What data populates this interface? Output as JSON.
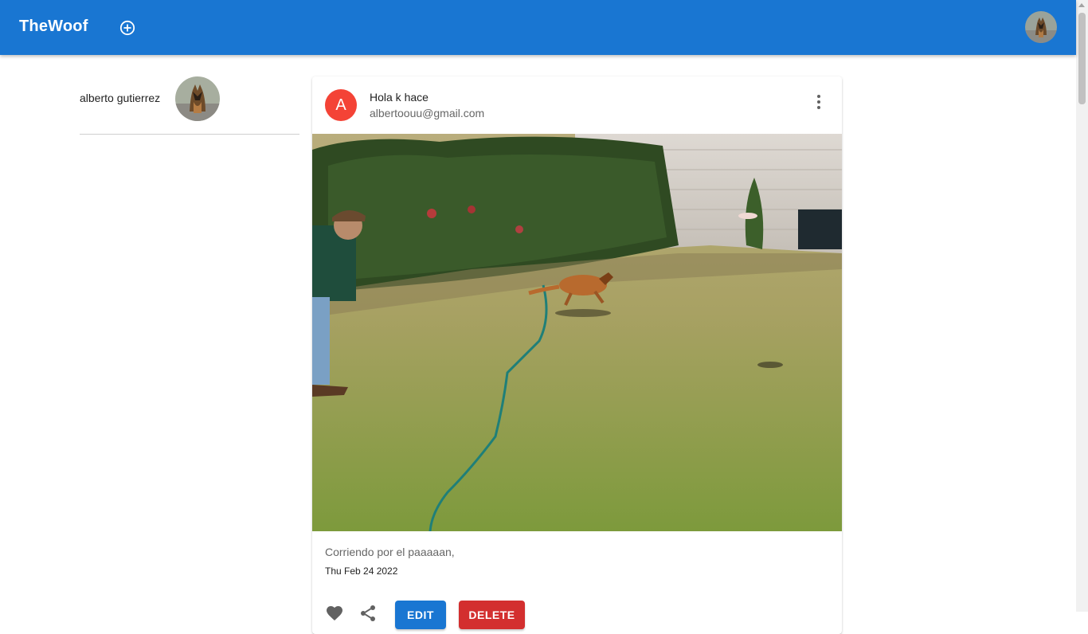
{
  "app": {
    "title": "TheWoof"
  },
  "header": {
    "add_icon": "add-circle-icon",
    "avatar_alt": "user-avatar"
  },
  "sidebar": {
    "profile_name": "alberto gutierrez"
  },
  "post": {
    "avatar_letter": "A",
    "title": "Hola k hace",
    "subtitle": "albertoouu@gmail.com",
    "description": "Corriendo por el paaaaan,",
    "date": "Thu Feb 24 2022",
    "actions": {
      "like_icon": "heart-icon",
      "share_icon": "share-icon",
      "edit_label": "EDIT",
      "delete_label": "DELETE"
    }
  },
  "colors": {
    "appbar": "#1976d2",
    "avatar_bg": "#f44336",
    "edit_btn": "#1976d2",
    "delete_btn": "#d32f2f"
  }
}
